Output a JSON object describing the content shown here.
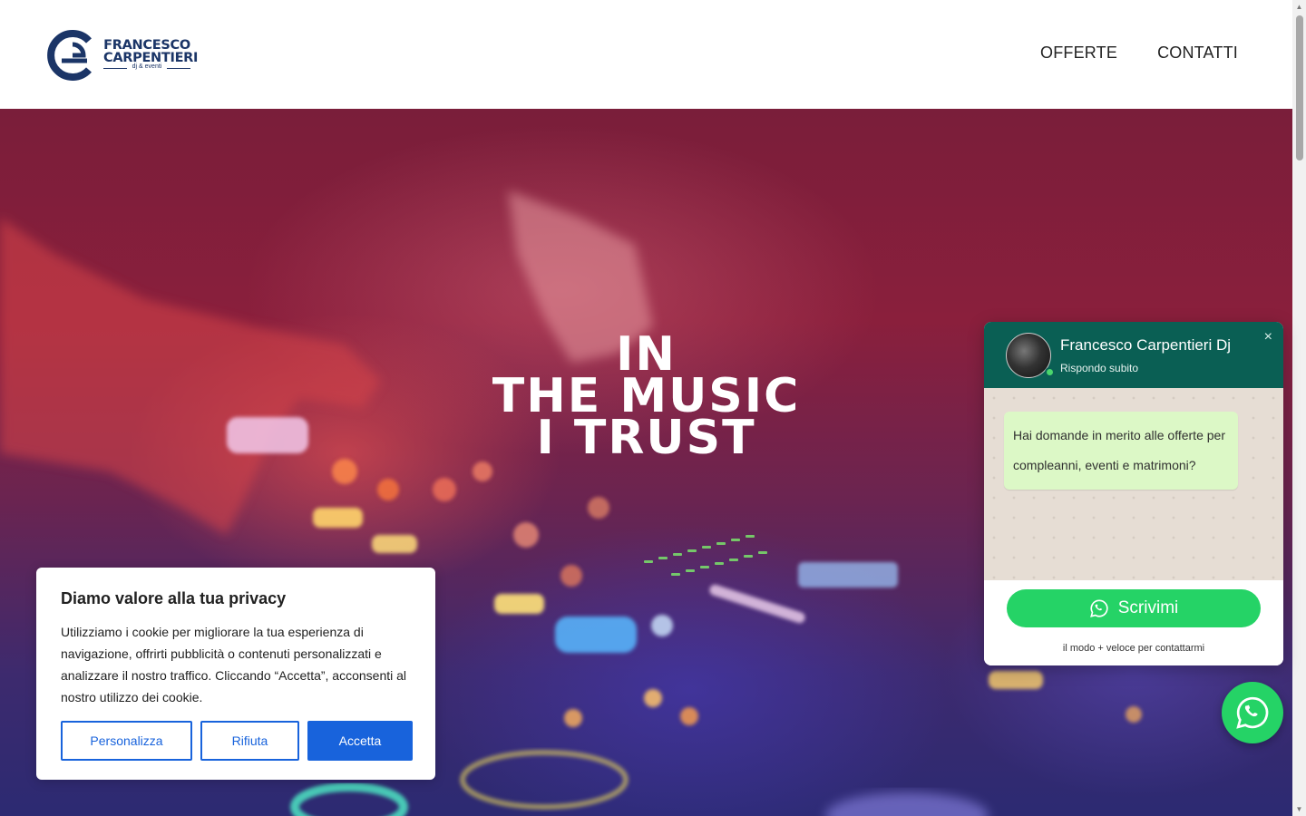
{
  "header": {
    "logo": {
      "line1": "FRANCESCO",
      "line2": "CARPENTIERI",
      "tagline": "dj & eventi",
      "brand_color": "#1b3567"
    },
    "nav": [
      {
        "label": "OFFERTE"
      },
      {
        "label": "CONTATTI"
      }
    ]
  },
  "hero": {
    "line1": "IN",
    "line2": "THE MUSIC",
    "line3": "I TRUST"
  },
  "cookie_banner": {
    "title": "Diamo valore alla tua privacy",
    "text": "Utilizziamo i cookie per migliorare la tua esperienza di navigazione, offrirti pubblicità o contenuti personalizzati e analizzare il nostro traffico. Cliccando “Accetta”, acconsenti al nostro utilizzo dei cookie.",
    "buttons": {
      "customize": "Personalizza",
      "reject": "Rifiuta",
      "accept": "Accetta"
    },
    "accent_color": "#1863dc"
  },
  "whatsapp": {
    "name": "Francesco Carpentieri Dj",
    "status": "Rispondo subito",
    "close": "×",
    "message": "Hai domande in merito alle offerte per compleanni, eventi e matrimoni?",
    "button_label": "Scrivimi",
    "note": " il modo + veloce per contattarmi",
    "icon": "whatsapp-icon",
    "header_color": "#0a5f54",
    "button_color": "#25d366"
  }
}
